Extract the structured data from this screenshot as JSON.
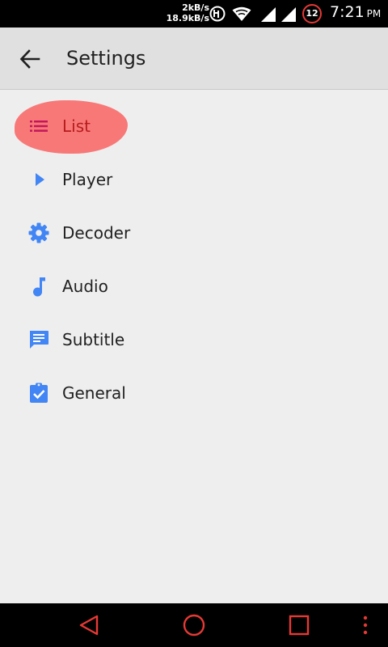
{
  "status_bar": {
    "net_speed_up": "2kB/s",
    "net_speed_down": "18.9kB/s",
    "notification_count": "12",
    "time": "7:21",
    "ampm": "PM",
    "icons": [
      "hotspot-icon",
      "wifi-icon",
      "signal-icon",
      "signal-icon"
    ]
  },
  "toolbar": {
    "back_icon": "arrow-back-icon",
    "title": "Settings"
  },
  "settings": {
    "items": [
      {
        "label": "List",
        "icon": "list-icon",
        "highlighted": true
      },
      {
        "label": "Player",
        "icon": "play-icon"
      },
      {
        "label": "Decoder",
        "icon": "gear-icon"
      },
      {
        "label": "Audio",
        "icon": "music-note-icon"
      },
      {
        "label": "Subtitle",
        "icon": "subtitle-icon"
      },
      {
        "label": "General",
        "icon": "assignment-check-icon"
      }
    ]
  },
  "nav_bar": {
    "buttons": [
      "back-triangle-icon",
      "home-circle-icon",
      "recents-square-icon",
      "overflow-menu-icon"
    ]
  },
  "colors": {
    "accent": "#4285f4",
    "highlight": "#f87171",
    "nav_icon": "#e53935"
  }
}
